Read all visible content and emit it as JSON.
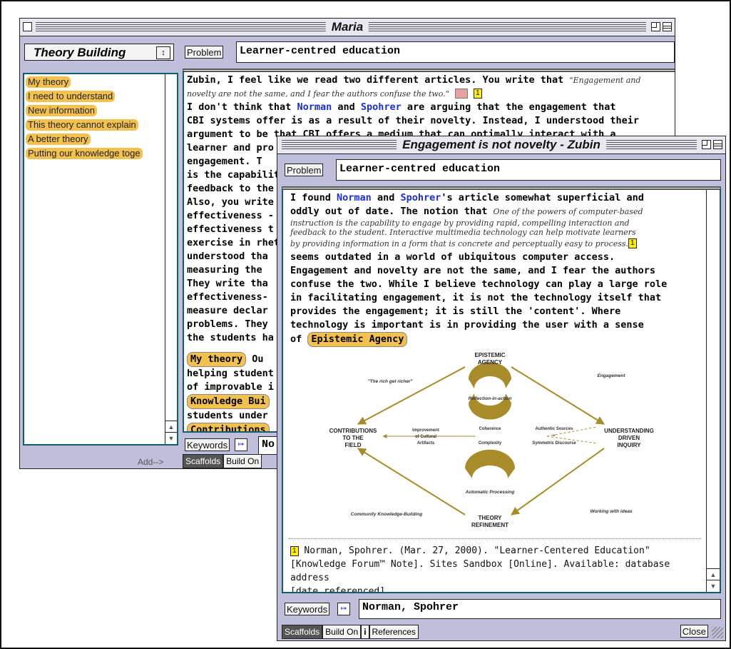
{
  "maria": {
    "title": "Maria",
    "view_selector": "Theory Building",
    "view_arrows": "↕",
    "problem_button": "Problem",
    "problem_value": "Learner-centred education",
    "scaffold_items": [
      "My theory",
      "I need to understand",
      "New information",
      "This theory cannot explain",
      "A better theory",
      "Putting our knowledge toge"
    ],
    "add_label": "Add-->",
    "keywords_button": "Keywords",
    "keywords_value": "No",
    "tabs": [
      "Scaffolds",
      "Build On"
    ],
    "body": {
      "p1_start": "Zubin, I feel like we read two different articles.  You write that ",
      "p1_quote": "\"Engagement and novelty are not the same, and I fear the authors confuse the two.\"",
      "ref": "1",
      "line2": "I don't think that ",
      "author1": "Norman",
      "and": " and ",
      "author2": "Spohrer",
      "line2_end": " are arguing that the engagement that",
      "lines": [
        "CBI systems offer is as a result of their novelty.  Instead, I understood their",
        "argument to be that CBI offers a medium that can optimally interact with a",
        "learner and pro",
        "engagement.  T",
        "is the capabilit",
        "feedback to the",
        "Also, you write",
        "effectiveness -",
        "effectiveness t",
        "exercise in rhet",
        "understood tha",
        "measuring the",
        "They write tha",
        "effectiveness-",
        "measure declar",
        "problems. They",
        "the students ha"
      ],
      "s1": "My theory",
      "s1_after": " Ou",
      "lines2": [
        "helping student",
        "of improvable i"
      ],
      "s2": "Knowledge Bui",
      "line3": "students under",
      "s3": "Contributions"
    }
  },
  "zubin": {
    "title": "Engagement is not novelty - Zubin",
    "problem_button": "Problem",
    "problem_value": "Learner-centred education",
    "body": {
      "l1a": "I found ",
      "author1": "Norman",
      "and": " and ",
      "author2": "Spohrer",
      "l1b": "'s article somewhat superficial and",
      "l2a": "oddly out of date.  The notion that ",
      "quote1": "One of the powers of computer-based",
      "quote2": "instruction is the capability to engage by  providing rapid, compelling interaction and",
      "quote3": "feedback to the student. Interactive multimedia technology can help motivate learners",
      "quote4": "by providing information in a form that is concrete and perceptually easy to process.",
      "ref": "1",
      "lines": [
        "seems outdated in a world of ubiquitous computer access.",
        "Engagement and novelty are not the same, and I fear the authors",
        "confuse the two.  While I believe technology can play a large role",
        "in facilitating engagement, it is not the technology itself that",
        "provides the engagement; it is still the 'content'.  Where",
        "technology is important is in providing the user with a sense"
      ],
      "last_a": "of ",
      "scaffold": "Epistemic Agency"
    },
    "diagram": {
      "top1": "EPISTEMIC",
      "top2": "AGENCY",
      "reflection": "Reflection-in-action",
      "left1": "CONTRIBUTIONS",
      "left2": "TO THE",
      "left3": "FIELD",
      "right1": "UNDERSTANDING",
      "right2": "DRIVEN",
      "right3": "INQUIRY",
      "bottom1": "THEORY",
      "bottom2": "REFINEMENT",
      "rich": "\"The rich get richer\"",
      "engagement": "Engagement",
      "community": "Community Knowledge-Building",
      "working": "Working with ideas",
      "improve1": "Improvement",
      "improve2": "of Cultural",
      "improve3": "Artifacts",
      "coherence": "Coherence",
      "complexity": "Complexity",
      "auth1": "Authentic Sources",
      "auth2": "+",
      "auth3": "Symmetric Discourse",
      "auto": "Automatic Processing"
    },
    "ref_text1": " Norman, Spohrer. (Mar. 27, 2000). \"Learner-Centered Education\"",
    "ref_text2": "[Knowledge Forum™ Note]. Sites Sandbox [Online]. Available: database address",
    "ref_text3": "[date referenced].",
    "keywords_button": "Keywords",
    "keywords_value": "Norman, Spohrer",
    "tabs": [
      "Scaffolds",
      "Build On",
      "i",
      "References"
    ],
    "close_button": "Close",
    "accent": "#0e5f6a",
    "scaffold_color": "#f2c14e",
    "author_color": "#1a2ee0"
  }
}
